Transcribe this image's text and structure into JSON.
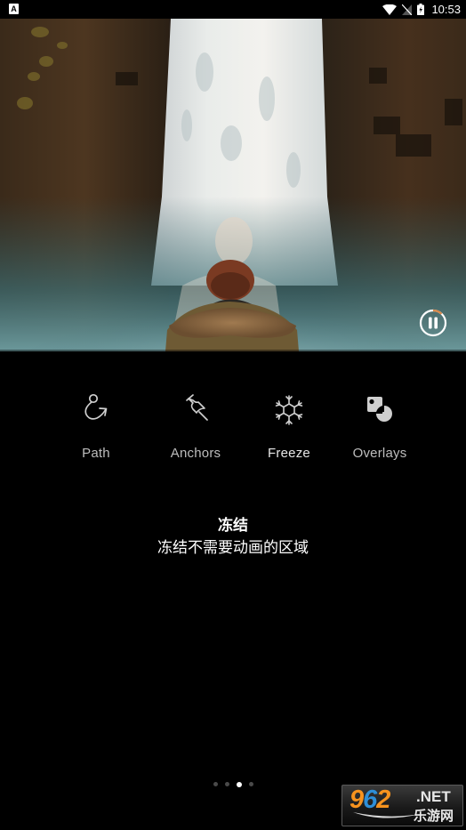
{
  "status_bar": {
    "left_icon": "A",
    "left_icon_name": "notification-app-icon",
    "icons": [
      "wifi-icon",
      "no-sim-icon",
      "battery-charging-icon"
    ],
    "time": "10:53"
  },
  "hero": {
    "description": "waterfall-with-person-in-fur-hood",
    "playback_state": "playing",
    "control": "pause",
    "progress_fraction": 0.12,
    "progress_color": "#d9894a"
  },
  "features": [
    {
      "label": "Path",
      "icon": "path-arrow-icon",
      "active": false
    },
    {
      "label": "Anchors",
      "icon": "pushpin-icon",
      "active": false
    },
    {
      "label": "Freeze",
      "icon": "snowflake-icon",
      "active": true
    },
    {
      "label": "Overlays",
      "icon": "overlays-shapes-icon",
      "active": false
    }
  ],
  "description": {
    "title": "冻结",
    "body": "冻结不需要动画的区域"
  },
  "pager": {
    "total": 4,
    "current_index": 2
  },
  "watermark": {
    "num_a": "9",
    "num_b": "6",
    "num_c": "2",
    "net": ".NET",
    "cn": "乐游网"
  }
}
